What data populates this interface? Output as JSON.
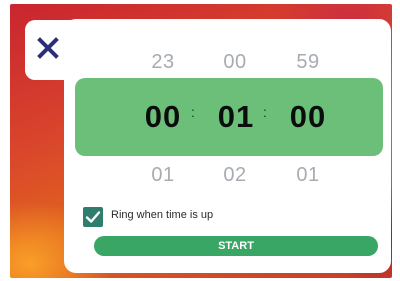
{
  "icons": {
    "close": "close-icon",
    "check": "checkmark-icon"
  },
  "colors": {
    "picker_band": "#6cbf79",
    "checkbox": "#2f7d6c",
    "start_button": "#3aa665",
    "close_icon": "#2b2f7a"
  },
  "timer": {
    "previous": {
      "hours": "23",
      "minutes": "00",
      "seconds": "59"
    },
    "selected": {
      "hours": "00",
      "minutes": "01",
      "seconds": "00"
    },
    "next": {
      "hours": "01",
      "minutes": "02",
      "seconds": "01"
    },
    "separator": ":"
  },
  "options": {
    "ring_label": "Ring when time is up",
    "ring_checked": true
  },
  "actions": {
    "start_label": "START"
  }
}
